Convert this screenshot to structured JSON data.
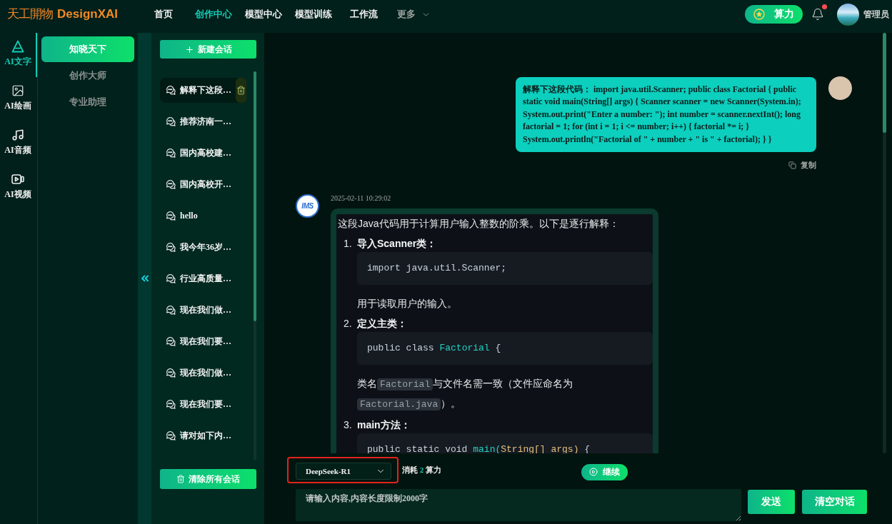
{
  "header": {
    "logo": {
      "mark": "天工開物",
      "name": "DesignXAI"
    },
    "nav": [
      {
        "label": "首页",
        "selected": false
      },
      {
        "label": "创作中心",
        "selected": true
      },
      {
        "label": "模型中心",
        "selected": false
      },
      {
        "label": "模型训练",
        "selected": false
      },
      {
        "label": "工作流",
        "selected": false
      }
    ],
    "more": {
      "label": "更多"
    },
    "credits_button": "算力",
    "notifications": {
      "unread": true
    },
    "user": {
      "name": "管理员"
    }
  },
  "rail": {
    "items": [
      {
        "label": "AI文字",
        "kind": "text",
        "selected": true
      },
      {
        "label": "AI绘画",
        "kind": "image",
        "selected": false
      },
      {
        "label": "AI音频",
        "kind": "audio",
        "selected": false
      },
      {
        "label": "AI视频",
        "kind": "video",
        "selected": false
      }
    ]
  },
  "modes": {
    "items": [
      {
        "label": "知晓天下",
        "selected": true
      },
      {
        "label": "创作大师",
        "selected": false
      },
      {
        "label": "专业助理",
        "selected": false
      }
    ]
  },
  "conversations": {
    "new_button": "新建会话",
    "items": [
      {
        "title": "解释下这段…",
        "selected": true
      },
      {
        "title": "推荐济南一…",
        "selected": false
      },
      {
        "title": "国内高校建…",
        "selected": false
      },
      {
        "title": "国内高校开…",
        "selected": false
      },
      {
        "title": "hello",
        "selected": false
      },
      {
        "title": "我今年36岁…",
        "selected": false
      },
      {
        "title": "行业高质量…",
        "selected": false
      },
      {
        "title": "现在我们做…",
        "selected": false
      },
      {
        "title": "现在我们要…",
        "selected": false
      },
      {
        "title": "现在我们做…",
        "selected": false
      },
      {
        "title": "现在我们要…",
        "selected": false
      },
      {
        "title": "请对如下内…",
        "selected": false
      }
    ],
    "clear_button": "清除所有会话"
  },
  "chat": {
    "messages": [
      {
        "kind": "user",
        "text": "解释下这段代码： import java.util.Scanner; public class Factorial { public static void main(String[] args) { Scanner scanner = new Scanner(System.in); System.out.print(\"Enter a number: \"); int number = scanner.nextInt(); long factorial = 1; for (int i = 1; i <= number; i++) { factorial *= i; } System.out.println(\"Factorial of \" + number + \" is \" + factorial); } }",
        "copy_label": "复制"
      },
      {
        "kind": "assistant",
        "avatar_label": "IMS",
        "time": "2025-02-11 10:29:02",
        "content": [
          {
            "kind": "paragraph",
            "parts": [
              {
                "kind": "text",
                "text": "这段Java代码用于计算用户输入整数的阶乘。以下是逐行解释："
              }
            ]
          },
          {
            "kind": "step",
            "number": "1.",
            "title": "导入Scanner类：",
            "blocks": [
              {
                "kind": "code",
                "tokens": [
                  {
                    "kind": "plain",
                    "text": "import java.util.Scanner;"
                  }
                ]
              },
              {
                "kind": "paragraph",
                "parts": [
                  {
                    "kind": "text",
                    "text": "用于读取用户的输入。"
                  }
                ]
              }
            ]
          },
          {
            "kind": "step",
            "number": "2.",
            "title": "定义主类：",
            "blocks": [
              {
                "kind": "code",
                "tokens": [
                  {
                    "kind": "plain",
                    "text": "public class "
                  },
                  {
                    "kind": "name",
                    "text": "Factorial"
                  },
                  {
                    "kind": "plain",
                    "text": " {"
                  }
                ]
              },
              {
                "kind": "paragraph",
                "parts": [
                  {
                    "kind": "text",
                    "text": "类名"
                  },
                  {
                    "kind": "code",
                    "text": "Factorial"
                  },
                  {
                    "kind": "text",
                    "text": "与文件名需一致（文件应命名为"
                  },
                  {
                    "kind": "code",
                    "text": "Factorial.java"
                  },
                  {
                    "kind": "text",
                    "text": "）。"
                  }
                ]
              }
            ]
          },
          {
            "kind": "step",
            "number": "3.",
            "title": "main方法：",
            "blocks": [
              {
                "kind": "code",
                "tokens": [
                  {
                    "kind": "plain",
                    "text": "public static void "
                  },
                  {
                    "kind": "name",
                    "text": "main("
                  },
                  {
                    "kind": "param",
                    "text": "String[] args)"
                  },
                  {
                    "kind": "plain",
                    "text": " {"
                  }
                ]
              }
            ]
          }
        ]
      }
    ]
  },
  "composer": {
    "model_select": {
      "value": "DeepSeek-R1",
      "highlighted": true
    },
    "cost": {
      "prefix": "消耗",
      "amount": "2",
      "unit": "算力"
    },
    "continue_button": "继续",
    "input": {
      "placeholder": "请输入内容,内容长度限制2000字"
    },
    "send_button": "发送",
    "clear_button": "清空对话"
  }
}
